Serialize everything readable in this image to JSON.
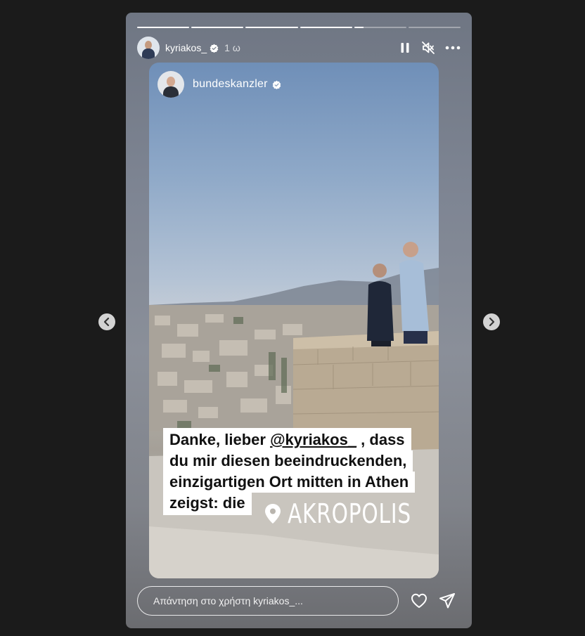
{
  "story": {
    "progress": [
      1,
      1,
      1,
      1,
      0.18,
      0
    ],
    "author": "kyriakos_",
    "time": "1 ω",
    "post": {
      "author": "bundeskanzler",
      "caption_lines": [
        {
          "before": "Danke, lieber ",
          "mention": "@kyriakos_",
          "after": " , dass"
        },
        {
          "before": "du mir diesen beeindruckenden,",
          "mention": "",
          "after": ""
        },
        {
          "before": "einzigartigen Ort mitten in Athen",
          "mention": "",
          "after": ""
        },
        {
          "before": "zeigst: die",
          "mention": "",
          "after": ""
        }
      ],
      "location": "AKROPOLIS"
    },
    "reply_placeholder": "Απάντηση στο χρήστη kyriakos_..."
  },
  "icons": {
    "verified": "verified-badge-icon",
    "pause": "pause-icon",
    "muted": "speaker-muted-icon",
    "more": "more-options-icon",
    "location": "location-pin-icon",
    "like": "heart-icon",
    "share": "send-icon",
    "prev": "chevron-left-icon",
    "next": "chevron-right-icon"
  },
  "colors": {
    "page_bg": "#1b1b1b",
    "text": "#ffffff",
    "caption_bg": "#ffffff"
  }
}
